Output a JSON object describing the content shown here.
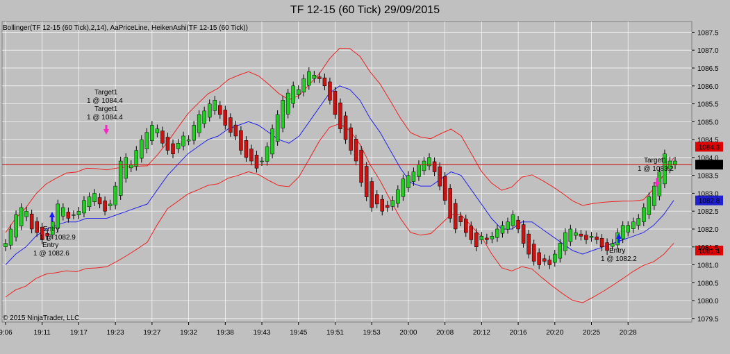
{
  "window": {
    "title": "TF 12-15 (60 Tick)  29/09/2015"
  },
  "indicator_label": "Bollinger(TF 12-15 (60 Tick),2,14), AaPriceLine, HeikenAshi(TF 12-15 (60 Tick))",
  "copyright": "© 2015 NinjaTrader, LLC",
  "colors": {
    "background": "#c0c0c0",
    "bull": "#22cc22",
    "bear": "#cc1111",
    "band": "#ee2222",
    "mid": "#2222ee",
    "price_line": "#cc0000",
    "grid": "#ffffff"
  },
  "chart_data": {
    "type": "candlestick",
    "title": "TF 12-15 (60 Tick)  29/09/2015",
    "ylim": [
      1079.4,
      1087.8
    ],
    "y_ticks": [
      "1079.5",
      "1080.0",
      "1080.5",
      "1081.0",
      "1081.5",
      "1082.0",
      "1082.5",
      "1083.0",
      "1083.5",
      "1084.0",
      "1084.5",
      "1085.0",
      "1085.5",
      "1086.0",
      "1086.5",
      "1087.0",
      "1087.5"
    ],
    "x_ticks": [
      "9:06",
      "19:11",
      "19:17",
      "19:23",
      "19:27",
      "19:32",
      "19:38",
      "19:43",
      "19:45",
      "19:51",
      "19:53",
      "20:00",
      "20:08",
      "20:12",
      "20:16",
      "20:20",
      "20:25",
      "20:28"
    ],
    "grid": true,
    "price_line_value": 1083.8,
    "price_badges": [
      {
        "label": "1084.3",
        "value": 1084.3,
        "color": "#e00000"
      },
      {
        "label": "1083.8",
        "value": 1083.8,
        "color": "#000000"
      },
      {
        "label": "1082.8",
        "value": 1082.8,
        "color": "#2020d0"
      },
      {
        "label": "1081.4",
        "value": 1081.4,
        "color": "#e00000"
      }
    ],
    "closes": [
      1081.6,
      1082.0,
      1082.4,
      1082.6,
      1082.5,
      1082.0,
      1081.9,
      1081.7,
      1081.8,
      1082.2,
      1082.7,
      1082.6,
      1082.3,
      1082.4,
      1082.5,
      1082.8,
      1082.9,
      1083.0,
      1082.7,
      1082.5,
      1082.7,
      1083.2,
      1083.9,
      1084.0,
      1083.8,
      1084.2,
      1084.5,
      1084.7,
      1084.9,
      1084.8,
      1084.4,
      1084.2,
      1084.1,
      1084.4,
      1084.6,
      1084.5,
      1084.9,
      1085.2,
      1085.3,
      1085.5,
      1085.6,
      1085.2,
      1084.9,
      1084.7,
      1084.6,
      1084.2,
      1084.0,
      1083.9,
      1083.7,
      1083.9,
      1084.3,
      1084.8,
      1085.2,
      1085.6,
      1085.8,
      1086.0,
      1085.9,
      1086.2,
      1086.4,
      1086.3,
      1086.2,
      1086.0,
      1085.6,
      1085.2,
      1084.8,
      1084.5,
      1084.2,
      1083.9,
      1083.3,
      1082.9,
      1082.6,
      1082.7,
      1082.5,
      1082.6,
      1082.8,
      1083.1,
      1083.4,
      1083.5,
      1083.6,
      1083.8,
      1083.9,
      1084.0,
      1083.6,
      1083.2,
      1082.8,
      1082.3,
      1082.0,
      1082.2,
      1081.9,
      1081.7,
      1081.5,
      1081.8,
      1081.7,
      1081.8,
      1082.0,
      1082.1,
      1082.2,
      1082.4,
      1082.0,
      1081.6,
      1081.3,
      1081.1,
      1081.0,
      1081.1,
      1081.0,
      1081.3,
      1081.6,
      1081.9,
      1082.0,
      1081.9,
      1081.8,
      1081.7,
      1081.8,
      1081.7,
      1081.5,
      1081.4,
      1081.6,
      1081.9,
      1082.1,
      1082.1,
      1082.2,
      1082.3,
      1082.6,
      1082.9,
      1083.2,
      1083.6,
      1084.1,
      1083.9,
      1083.9
    ],
    "mid_band": [
      1081.0,
      1081.3,
      1081.5,
      1081.8,
      1082.0,
      1082.1,
      1082.2,
      1082.2,
      1082.3,
      1082.3,
      1082.3,
      1082.4,
      1082.5,
      1082.6,
      1082.7,
      1083.1,
      1083.5,
      1083.8,
      1084.1,
      1084.3,
      1084.5,
      1084.6,
      1084.8,
      1084.9,
      1085.0,
      1084.9,
      1084.7,
      1084.5,
      1084.4,
      1084.6,
      1085.0,
      1085.4,
      1085.8,
      1086.0,
      1085.9,
      1085.6,
      1085.1,
      1084.7,
      1084.2,
      1083.7,
      1083.3,
      1083.2,
      1083.2,
      1083.4,
      1083.6,
      1083.5,
      1083.1,
      1082.7,
      1082.3,
      1082.0,
      1082.0,
      1082.2,
      1082.2,
      1082.0,
      1081.8,
      1081.6,
      1081.4,
      1081.3,
      1081.4,
      1081.5,
      1081.6,
      1081.7,
      1081.8,
      1081.9,
      1082.1,
      1082.4,
      1082.8
    ]
  },
  "annotations": [
    {
      "line1": "Entry",
      "line2": "1 @ 1082.9"
    },
    {
      "line1": "Entry",
      "line2": "1 @ 1082.6"
    },
    {
      "line1": "Target1",
      "line2": "1 @ 1084.4"
    },
    {
      "line1": "Target1",
      "line2": "1 @ 1084.4"
    },
    {
      "line1": "Entry",
      "line2": "1 @ 1082.2"
    },
    {
      "line1": "Target1",
      "line2": "1 @ 1083.2"
    }
  ]
}
